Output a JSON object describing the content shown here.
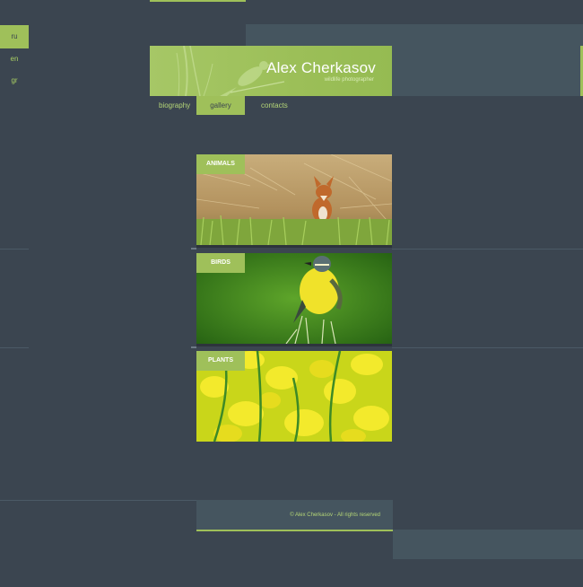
{
  "site": {
    "title": "Alex Cherkasov",
    "subtitle": "wildlife photographer"
  },
  "languages": [
    {
      "label": "ru",
      "active": true
    },
    {
      "label": "en",
      "active": false
    },
    {
      "label": "gr",
      "active": false
    }
  ],
  "nav": {
    "biography": "biography",
    "gallery": "gallery",
    "contacts": "contacts"
  },
  "gallery": [
    {
      "label": "ANIMALS",
      "image": "fox-in-grass-photo"
    },
    {
      "label": "BIRDS",
      "image": "yellow-wagtail-photo"
    },
    {
      "label": "PLANTS",
      "image": "yellow-rapeseed-flowers-photo"
    }
  ],
  "footer": {
    "copyright": "© Alex Cherkasov - All rights reserved"
  },
  "colors": {
    "background": "#3b4550",
    "accent": "#9fc05a",
    "panel": "#45555f"
  }
}
